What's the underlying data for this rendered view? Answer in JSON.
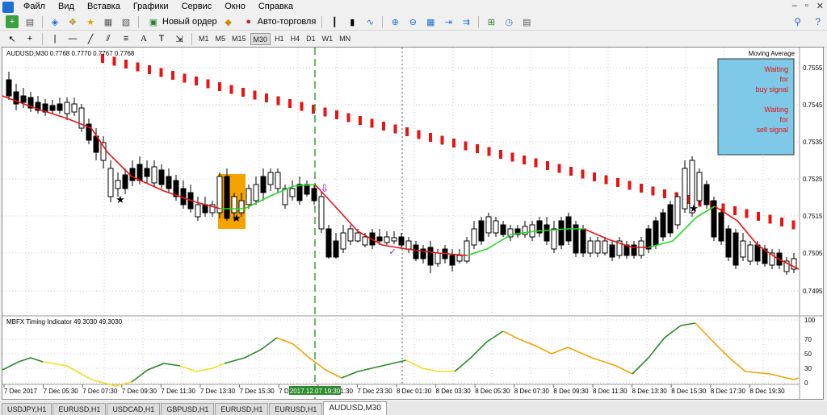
{
  "menu": {
    "items": [
      "Файл",
      "Вид",
      "Вставка",
      "Графики",
      "Сервис",
      "Окно",
      "Справка"
    ]
  },
  "toolbar": {
    "new_order": "Новый ордер",
    "autotrading": "Авто-торговля"
  },
  "timeframes": [
    "M1",
    "M5",
    "M15",
    "M30",
    "H1",
    "H4",
    "D1",
    "W1",
    "MN"
  ],
  "active_timeframe": "M30",
  "chart": {
    "title": "AUDUSD,M30  0.7768 0.7770 0.7767 0.7768",
    "indicator_name": "Moving Average",
    "subwindow_title": "MBFX Timing Indicator 49.3030 49.3030",
    "signal_box": [
      "Waiting",
      "for",
      "buy signal",
      "",
      "Waiting",
      "for",
      "sell signal"
    ],
    "price_labels": [
      "0.7555",
      "0.7545",
      "0.7535",
      "0.7525",
      "0.7515",
      "0.7505",
      "0.7495"
    ],
    "osc_labels": [
      "100",
      "70",
      "50",
      "30",
      "0"
    ],
    "time_labels": [
      "7 Dec 2017",
      "7 Dec 05:30",
      "7 Dec 07:30",
      "7 Dec 09:30",
      "7 Dec 11:30",
      "7 Dec 13:30",
      "7 Dec 15:30",
      "7 Dec",
      "7 Dec 21:30",
      "7 Dec 23:30",
      "8 Dec 01:30",
      "8 Dec 03:30",
      "8 Dec 05:30",
      "8 Dec 07:30",
      "8 Dec 09:30",
      "8 Dec 11:30",
      "8 Dec 13:30",
      "8 Dec 15:30",
      "8 Dec 17:30",
      "8 Dec 19:30"
    ],
    "time_highlight": "2017.12.07 19:30",
    "colors": {
      "up_line": "#22dd22",
      "down_line": "#ee1111",
      "dots": "#ee1111",
      "signal_bg": "#7ec8e8",
      "signal_text": "#e81010",
      "highlight": "#f5a300",
      "vline": "#3a9d3a",
      "osc_green": "#2a8a2a",
      "osc_yellow": "#f0e020",
      "osc_orange": "#f5a300"
    }
  },
  "tabs": [
    "USDJPY,H1",
    "EURUSD,H1",
    "USDCAD,H1",
    "GBPUSD,H1",
    "EURUSD,H1",
    "EURUSD,H1",
    "AUDUSD,M30"
  ],
  "active_tab": "AUDUSD,M30"
}
